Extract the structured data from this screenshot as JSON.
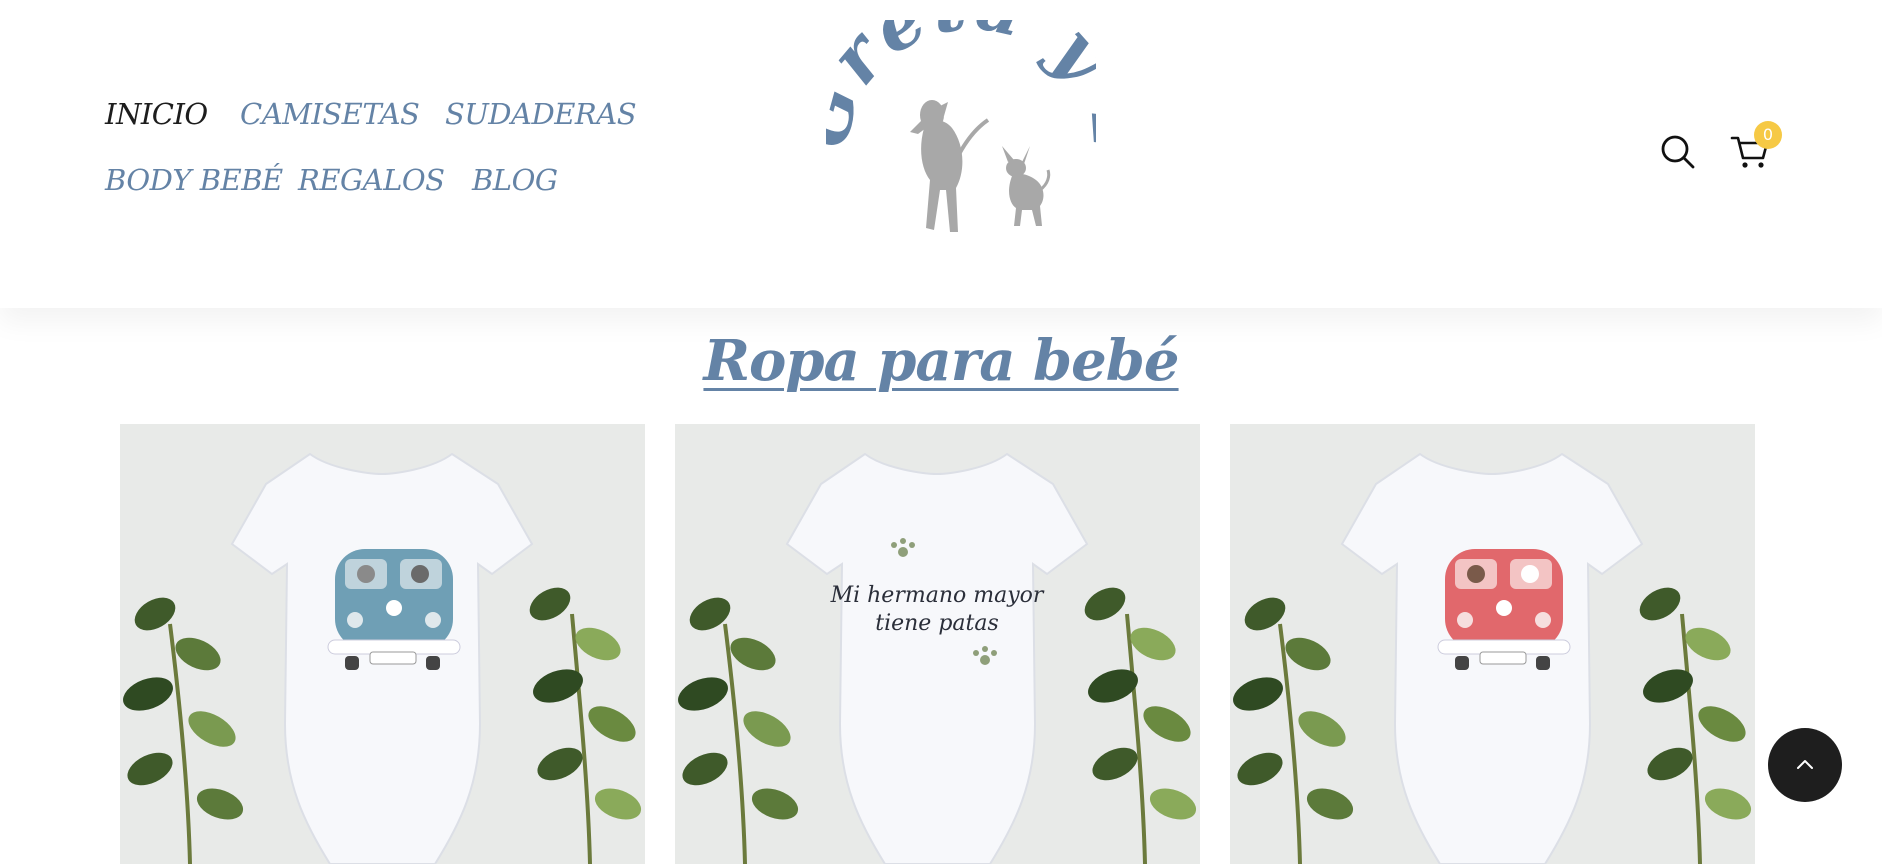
{
  "nav": {
    "items": [
      {
        "label": "INICIO",
        "active": true
      },
      {
        "label": "CAMISETAS",
        "active": false
      },
      {
        "label": "SUDADERAS",
        "active": false
      },
      {
        "label": "BODY BEBÉ",
        "active": false
      },
      {
        "label": "REGALOS",
        "active": false
      },
      {
        "label": "BLOG",
        "active": false
      }
    ]
  },
  "logo": {
    "text": "Greta y Pío",
    "icon": "dogs-silhouette-logo"
  },
  "header_icons": {
    "search": "search-icon",
    "cart": "cart-icon",
    "cart_count": "0"
  },
  "main": {
    "title": "Ropa para bebé"
  },
  "products": [
    {
      "image": "baby-bodysuit-blue-van",
      "van_color": "#6f9fb5"
    },
    {
      "image": "baby-bodysuit-hermano-mayor",
      "print_line1": "Mi hermano mayor",
      "print_line2": "tiene patas"
    },
    {
      "image": "baby-bodysuit-red-van",
      "van_color": "#e1686c"
    }
  ],
  "scroll_top": {
    "icon": "chevron-up-icon"
  },
  "colors": {
    "accent": "#6483a6",
    "badge": "#f6c945",
    "dark": "#1e1e1e",
    "logo_grey": "#a8a8a8"
  }
}
